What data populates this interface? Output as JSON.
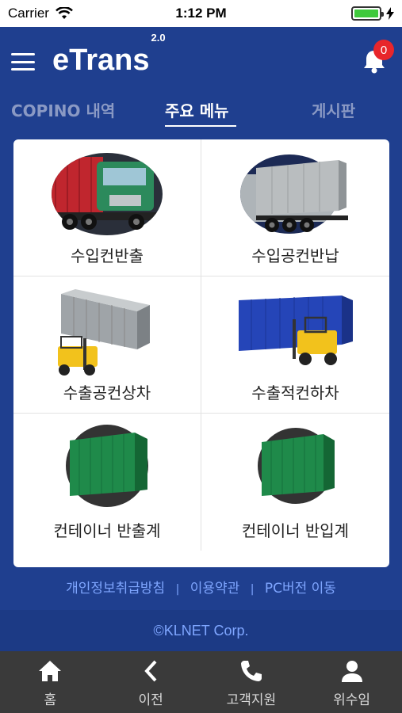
{
  "status_bar": {
    "carrier": "Carrier",
    "time": "1:12 PM"
  },
  "header": {
    "logo": "eTrans",
    "version": "2.0",
    "notification_count": "0"
  },
  "tabs": [
    {
      "label": "COPINO 내역",
      "active": false
    },
    {
      "label": "주요 메뉴",
      "active": true
    },
    {
      "label": "게시판",
      "active": false
    }
  ],
  "menu": [
    {
      "label": "수입컨반출",
      "icon": "red-green-truck"
    },
    {
      "label": "수입공컨반납",
      "icon": "gray-container-trailer"
    },
    {
      "label": "수출공컨상차",
      "icon": "forklift-lifting-gray-container"
    },
    {
      "label": "수출적컨하차",
      "icon": "blue-container-with-forklift"
    },
    {
      "label": "컨테이너 반출계",
      "icon": "green-container"
    },
    {
      "label": "컨테이너 반입계",
      "icon": "green-container"
    }
  ],
  "footer_links": {
    "privacy": "개인정보취급방침",
    "terms": "이용약관",
    "pc": "PC버전 이동",
    "separator": "|"
  },
  "copyright": "©KLNET Corp.",
  "bottom_nav": [
    {
      "label": "홈",
      "icon": "home-icon"
    },
    {
      "label": "이전",
      "icon": "back-icon"
    },
    {
      "label": "고객지원",
      "icon": "phone-icon"
    },
    {
      "label": "위수임",
      "icon": "person-icon"
    }
  ],
  "colors": {
    "background": "#1f3f8f",
    "accent_link": "#7fa6ff",
    "badge": "#e8262b",
    "nav": "#3a3a3a"
  }
}
